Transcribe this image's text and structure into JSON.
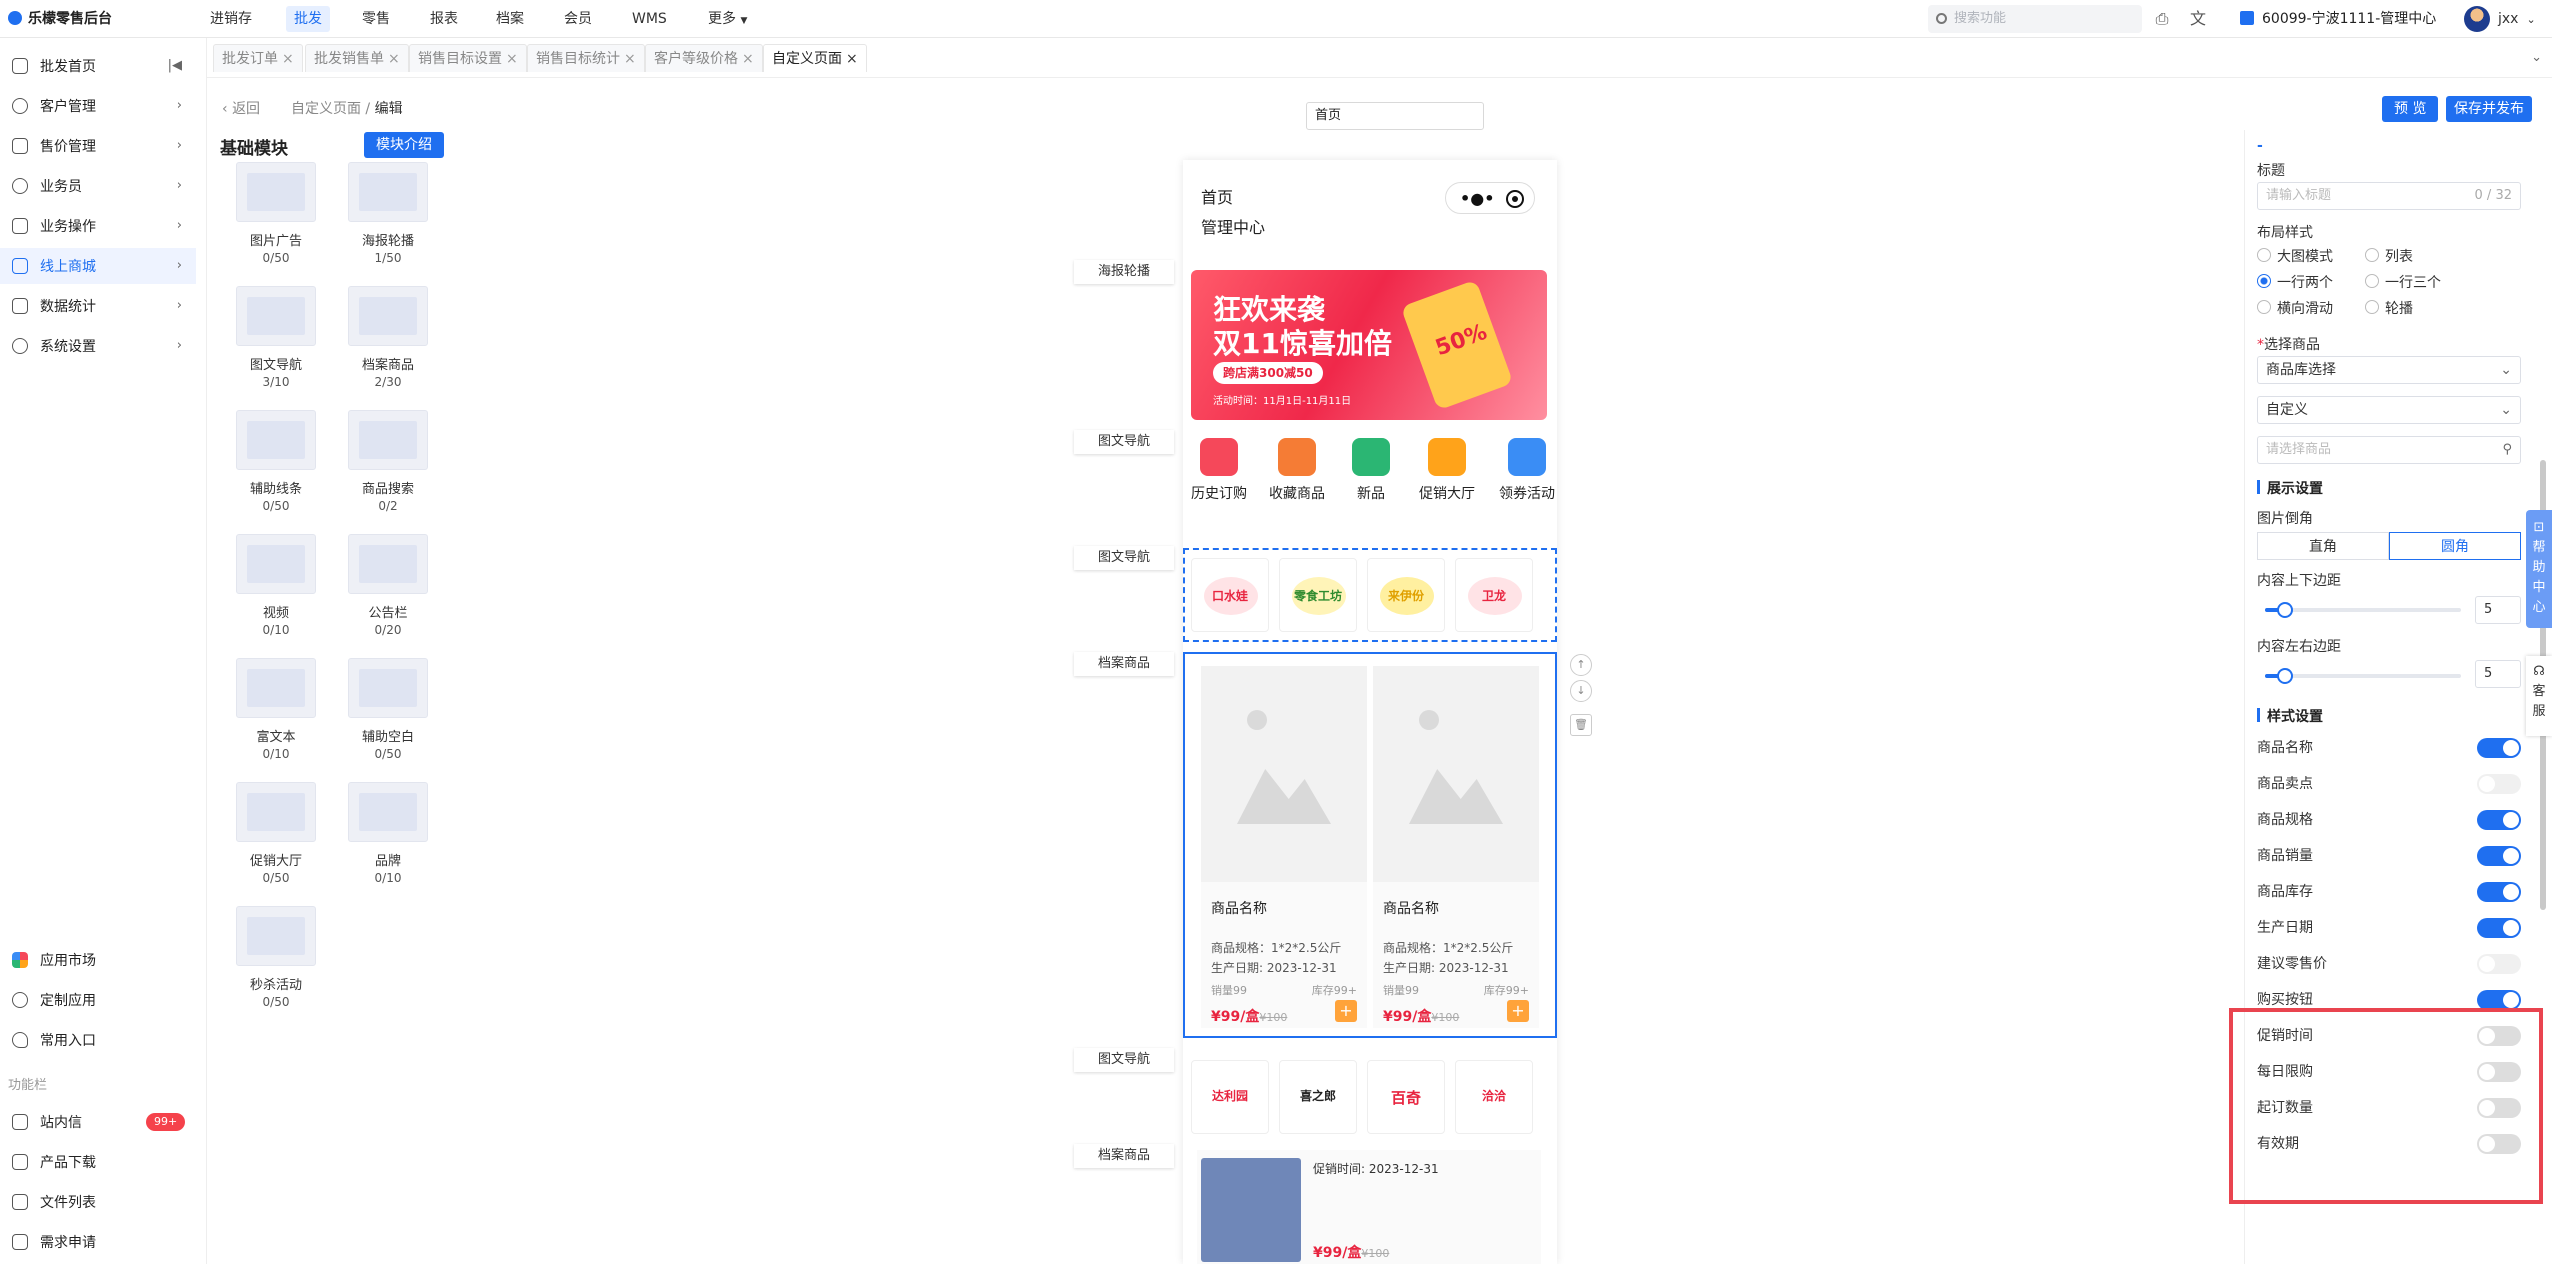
{
  "app": {
    "title": "乐檬零售后台"
  },
  "topnav": [
    {
      "label": "进销存",
      "active": false
    },
    {
      "label": "批发",
      "active": true
    },
    {
      "label": "零售",
      "active": false
    },
    {
      "label": "报表",
      "active": false
    },
    {
      "label": "档案",
      "active": false
    },
    {
      "label": "会员",
      "active": false
    },
    {
      "label": "WMS",
      "active": false
    },
    {
      "label": "更多",
      "active": false
    }
  ],
  "header": {
    "search_placeholder": "搜索功能",
    "store": "60099-宁波1111-管理中心",
    "user": "jxx"
  },
  "sidebar": {
    "items": [
      "批发首页",
      "客户管理",
      "售价管理",
      "业务员",
      "业务操作",
      "线上商城",
      "数据统计",
      "系统设置"
    ],
    "active_index": 5,
    "bottom": [
      "应用市场",
      "定制应用",
      "常用入口"
    ],
    "section": "功能栏",
    "func": [
      "站内信",
      "产品下载",
      "文件列表",
      "需求申请"
    ],
    "badge": "99+"
  },
  "tabs": [
    "批发订单",
    "批发销售单",
    "销售目标设置",
    "销售目标统计",
    "客户等级价格",
    "自定义页面"
  ],
  "breadcrumb": {
    "back": "返回",
    "parent": "自定义页面",
    "sep": "/",
    "current": "编辑"
  },
  "page_name": "首页",
  "buttons": {
    "preview": "预 览",
    "save": "保存并发布",
    "intro": "模块介绍"
  },
  "modules_title": "基础模块",
  "modules": [
    {
      "name": "图片广告",
      "count": "0/50"
    },
    {
      "name": "海报轮播",
      "count": "1/50"
    },
    {
      "name": "图文导航",
      "count": "3/10"
    },
    {
      "name": "档案商品",
      "count": "2/30"
    },
    {
      "name": "辅助线条",
      "count": "0/50"
    },
    {
      "name": "商品搜索",
      "count": "0/2"
    },
    {
      "name": "视频",
      "count": "0/10"
    },
    {
      "name": "公告栏",
      "count": "0/20"
    },
    {
      "name": "富文本",
      "count": "0/10"
    },
    {
      "name": "辅助空白",
      "count": "0/50"
    },
    {
      "name": "促销大厅",
      "count": "0/50"
    },
    {
      "name": "品牌",
      "count": "0/10"
    },
    {
      "name": "秒杀活动",
      "count": "0/50"
    }
  ],
  "canvas_labels": [
    "海报轮播",
    "图文导航",
    "图文导航",
    "档案商品",
    "图文导航",
    "档案商品"
  ],
  "phone": {
    "title": "首页",
    "subtitle": "管理中心"
  },
  "banner": {
    "line1": "狂欢来袭",
    "line2": "双11惊喜加倍",
    "tag": "跨店满300减50",
    "date": "活动时间：11月1日-11月11日",
    "pct": "50%"
  },
  "nav_items": [
    {
      "label": "历史订购",
      "color": "#f5485a"
    },
    {
      "label": "收藏商品",
      "color": "#f57c35"
    },
    {
      "label": "新品",
      "color": "#2bb673"
    },
    {
      "label": "促销大厅",
      "color": "#ffa31a"
    },
    {
      "label": "领券活动",
      "color": "#3a8df5"
    }
  ],
  "brands1": [
    {
      "text": "口水娃",
      "color": "#e8243f"
    },
    {
      "text": "零食工坊",
      "color": "#2f8b2f"
    },
    {
      "text": "来伊份",
      "color": "#e0a000"
    },
    {
      "text": "卫龙",
      "color": "#e8243f"
    }
  ],
  "goods": [
    {
      "name": "商品名称",
      "spec": "商品规格：1*2*2.5公斤",
      "date": "生产日期: 2023-12-31",
      "sales": "销量99",
      "stock": "库存99+",
      "price": "¥99/盒",
      "orig": "¥100"
    },
    {
      "name": "商品名称",
      "spec": "商品规格：1*2*2.5公斤",
      "date": "生产日期: 2023-12-31",
      "sales": "销量99",
      "stock": "库存99+",
      "price": "¥99/盒",
      "orig": "¥100"
    }
  ],
  "brands2": [
    {
      "text": "达利园",
      "color": "#e8243f"
    },
    {
      "text": "喜之郎",
      "color": "#222"
    },
    {
      "text": "百奇",
      "color": "#e8243f"
    },
    {
      "text": "洽洽",
      "color": "#e8243f"
    }
  ],
  "goods2": {
    "promo": "促销时间: 2023-12-31",
    "price": "¥99/盒",
    "orig": "¥100"
  },
  "rpanel": {
    "title_label": "标题",
    "title_placeholder": "请输入标题",
    "title_count": "0 / 32",
    "layout_label": "布局样式",
    "layouts": [
      {
        "label": "大图模式",
        "checked": false
      },
      {
        "label": "列表",
        "checked": false
      },
      {
        "label": "一行两个",
        "checked": true
      },
      {
        "label": "一行三个",
        "checked": false
      },
      {
        "label": "横向滑动",
        "checked": false
      },
      {
        "label": "轮播",
        "checked": false
      }
    ],
    "select_label": "选择商品",
    "select_value": "商品库选择",
    "custom_value": "自定义",
    "goods_search_placeholder": "请选择商品",
    "display_section": "展示设置",
    "corner_label": "图片倒角",
    "corner_options": [
      "直角",
      "圆角"
    ],
    "corner_selected": 1,
    "pad_v_label": "内容上下边距",
    "pad_v": 5,
    "pad_h_label": "内容左右边距",
    "pad_h": 5,
    "pad_max": 50,
    "style_section": "样式设置",
    "toggles": [
      {
        "label": "商品名称",
        "on": true
      },
      {
        "label": "商品卖点",
        "on": false,
        "dim": true
      },
      {
        "label": "商品规格",
        "on": true
      },
      {
        "label": "商品销量",
        "on": true
      },
      {
        "label": "商品库存",
        "on": true
      },
      {
        "label": "生产日期",
        "on": true
      },
      {
        "label": "建议零售价",
        "on": false,
        "dim": true
      },
      {
        "label": "购买按钮",
        "on": true
      },
      {
        "label": "促销时间",
        "on": false
      },
      {
        "label": "每日限购",
        "on": false
      },
      {
        "label": "起订数量",
        "on": false
      },
      {
        "label": "有效期",
        "on": false
      }
    ]
  },
  "side_tabs": {
    "help": "帮助中心",
    "service": "客服"
  },
  "colors": {
    "accent": "#1f6ff0",
    "danger": "#e9444f",
    "badge": "#f5424b"
  }
}
